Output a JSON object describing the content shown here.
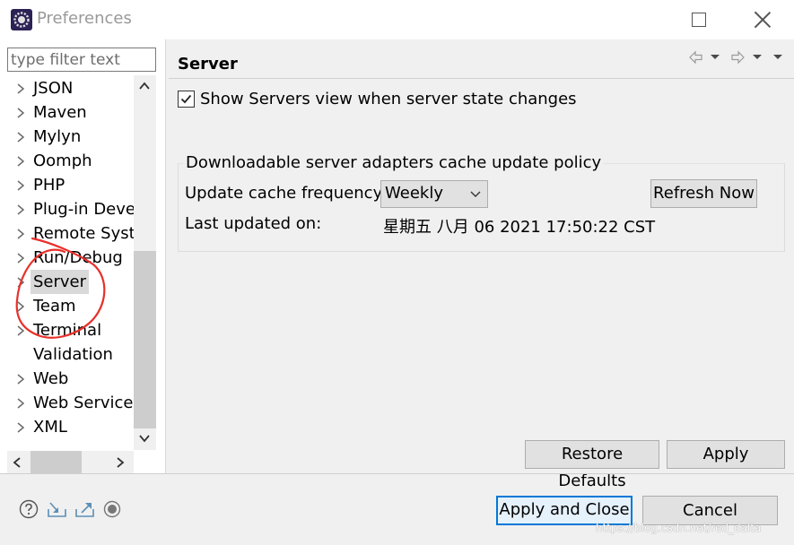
{
  "window": {
    "title": "Preferences"
  },
  "filter": {
    "placeholder": "type filter text"
  },
  "tree": {
    "items": [
      {
        "label": "JSON",
        "expandable": true
      },
      {
        "label": "Maven",
        "expandable": true
      },
      {
        "label": "Mylyn",
        "expandable": true
      },
      {
        "label": "Oomph",
        "expandable": true
      },
      {
        "label": "PHP",
        "expandable": true
      },
      {
        "label": "Plug-in Deve",
        "expandable": true
      },
      {
        "label": "Remote Syste",
        "expandable": true
      },
      {
        "label": "Run/Debug",
        "expandable": true
      },
      {
        "label": "Server",
        "expandable": true,
        "selected": true
      },
      {
        "label": "Team",
        "expandable": true
      },
      {
        "label": "Terminal",
        "expandable": true
      },
      {
        "label": "Validation",
        "expandable": false
      },
      {
        "label": "Web",
        "expandable": true
      },
      {
        "label": "Web Services",
        "expandable": true
      },
      {
        "label": "XML",
        "expandable": true
      }
    ]
  },
  "page": {
    "title": "Server",
    "show_servers_label": "Show Servers view when server state changes",
    "show_servers_checked": true
  },
  "cache_policy": {
    "group_title": "Downloadable server adapters cache update policy",
    "frequency_label": "Update cache frequency:",
    "frequency_value": "Weekly",
    "refresh_label": "Refresh Now",
    "last_updated_label": "Last updated on:",
    "last_updated_value": "星期五 八月 06 2021 17:50:22 CST"
  },
  "page_buttons": {
    "restore_defaults": "Restore Defaults",
    "apply": "Apply"
  },
  "dialog_buttons": {
    "apply_and_close": "Apply and Close",
    "cancel": "Cancel"
  },
  "footer_icons": [
    "help-icon",
    "import-icon",
    "export-icon",
    "record-icon"
  ],
  "watermark": "https://blog.csdn.net/red_dalta",
  "colors": {
    "annotation": "#e8302a",
    "focus_border": "#0078d7"
  }
}
